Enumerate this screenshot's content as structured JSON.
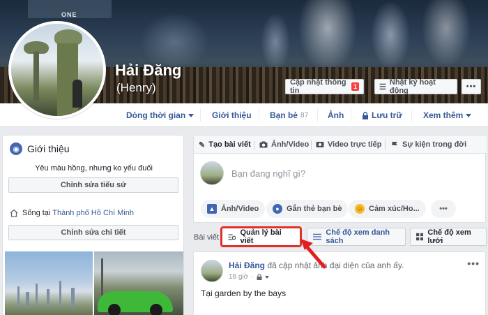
{
  "profile": {
    "name": "Hải Đăng",
    "nickname": "(Henry)",
    "update_info_label": "Cập nhật thông tin",
    "update_info_badge": "1",
    "activity_log_label": "Nhật ký hoạt động",
    "more_label": "•••",
    "cover_sign": "ONE"
  },
  "tabs": [
    {
      "label": "Dòng thời gian",
      "has_caret": true
    },
    {
      "label": "Giới thiệu"
    },
    {
      "label": "Bạn bè",
      "count": "87"
    },
    {
      "label": "Ảnh"
    },
    {
      "label": "Lưu trữ",
      "icon": "lock-icon"
    },
    {
      "label": "Xem thêm",
      "has_caret": true
    }
  ],
  "intro": {
    "title": "Giới thiệu",
    "bio": "Yêu màu hồng, nhưng ko yếu đuối",
    "edit_bio_label": "Chỉnh sửa tiểu sử",
    "lives_prefix": "Sống tại",
    "lives_city": "Thành phố Hồ Chí Minh",
    "edit_details_label": "Chỉnh sửa chi tiết"
  },
  "composer": {
    "tabs": [
      {
        "label": "Tạo bài viết",
        "icon": "pencil-icon"
      },
      {
        "label": "Ảnh/Video",
        "icon": "camera-icon"
      },
      {
        "label": "Video trực tiếp",
        "icon": "video-icon"
      },
      {
        "label": "Sự kiện trong đời",
        "icon": "flag-icon"
      }
    ],
    "placeholder": "Bạn đang nghĩ gì?",
    "actions": [
      {
        "label": "Ảnh/Video",
        "icon": "photo-icon",
        "color": "#4267b2"
      },
      {
        "label": "Gắn thẻ bạn bè",
        "icon": "tag-friends-icon",
        "color": "#4267b2"
      },
      {
        "label": "Cảm xúc/Ho...",
        "icon": "emoji-icon",
        "color": "#f7b928"
      },
      {
        "label": "•••",
        "icon": "more-icon"
      }
    ]
  },
  "posts_bar": {
    "label": "Bài viết",
    "manage_label": "Quản lý bài viết",
    "list_view_label": "Chế độ xem danh sách",
    "grid_view_label": "Chế độ xem lưới"
  },
  "post": {
    "author": "Hải Đăng",
    "action": "đã cập nhật ảnh đại diện của anh ấy.",
    "time": "18 giờ",
    "text": "Tại garden by the bays",
    "more_label": "•••"
  },
  "colors": {
    "link": "#365899",
    "highlight": "#e0302a",
    "brand": "#4267b2"
  }
}
